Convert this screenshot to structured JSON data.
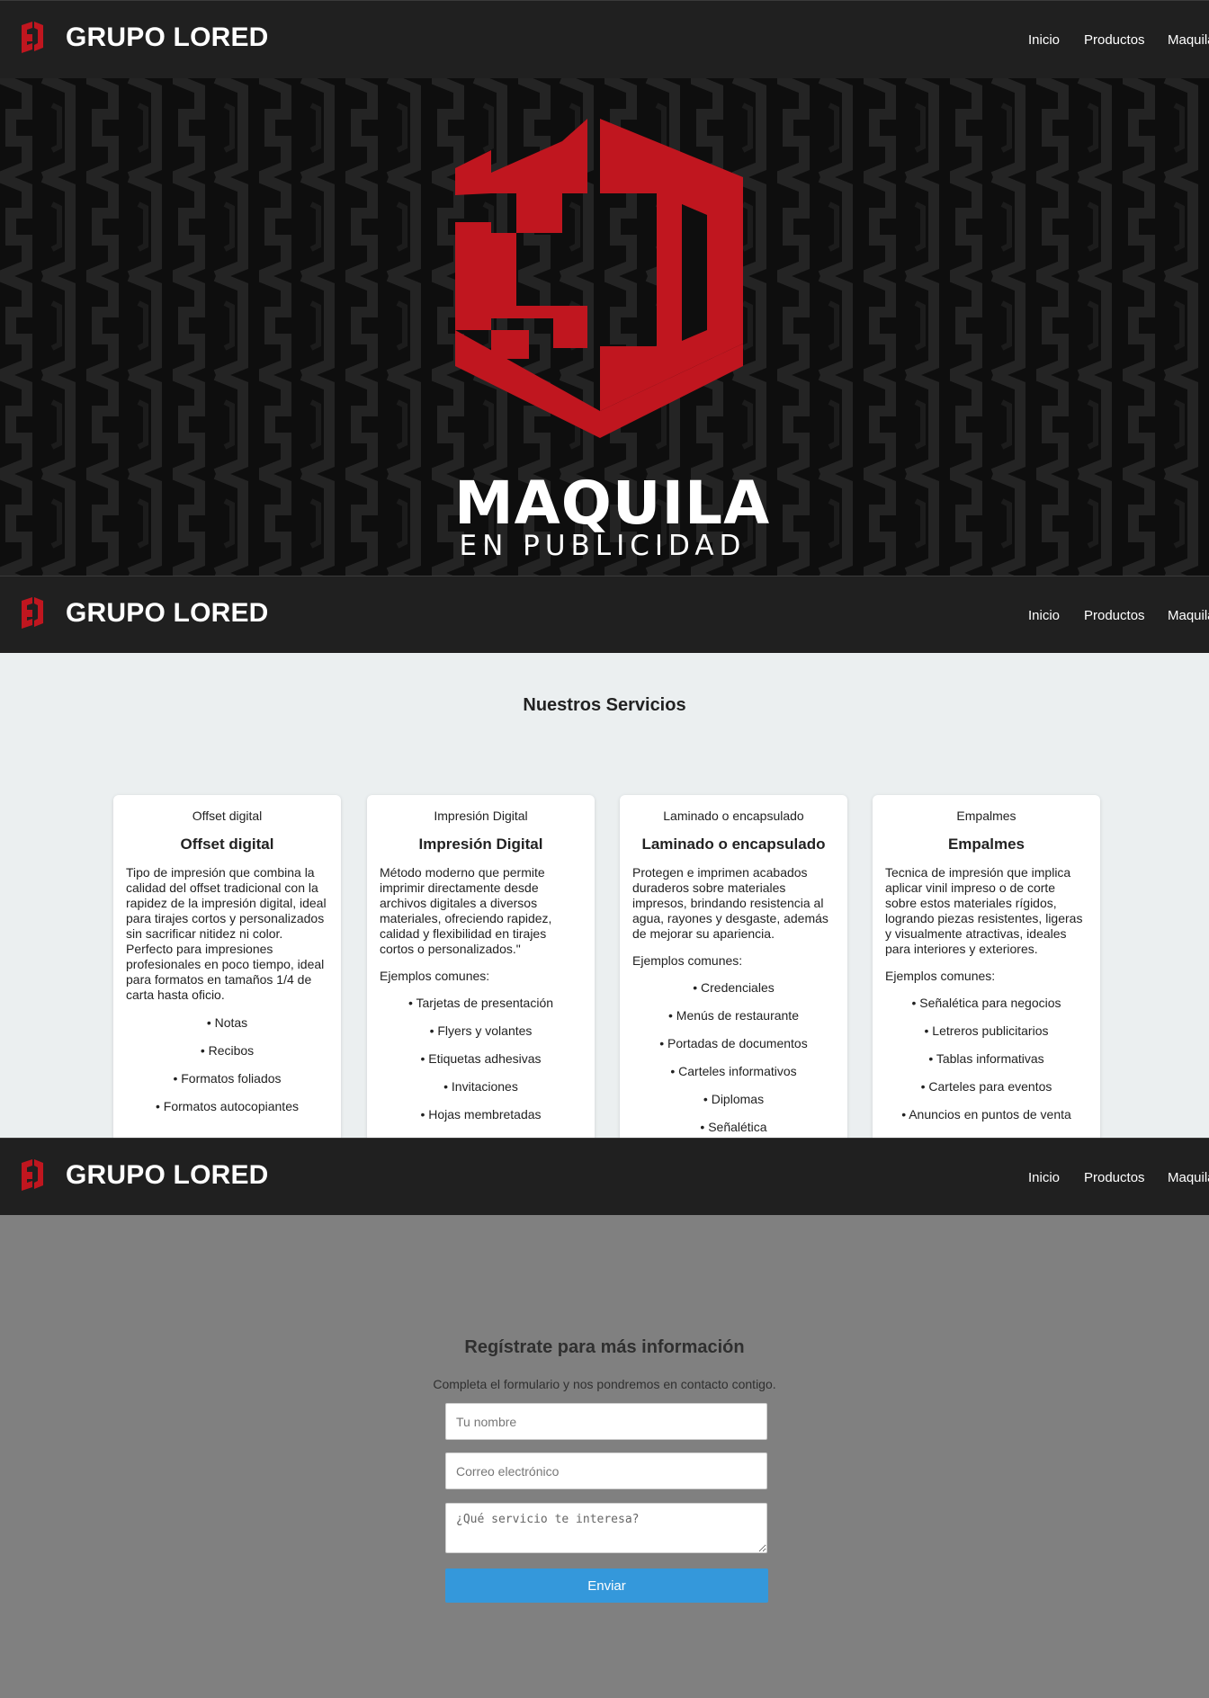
{
  "header": {
    "brand": "GRUPO LORED",
    "nav": [
      "Inicio",
      "Productos",
      "Maquila"
    ]
  },
  "hero": {
    "logo_title": "MAQUILA",
    "logo_subtitle": "EN PUBLICIDAD",
    "accent_color": "#c0161f"
  },
  "services": {
    "title": "Nuestros Servicios",
    "cards": [
      {
        "caption": "Offset digital",
        "title": "Offset digital",
        "description": "Tipo de impresión que combina la calidad del offset tradicional con la rapidez de la impresión digital, ideal para tirajes cortos y personalizados sin sacrificar nitidez ni color. Perfecto para impresiones profesionales en poco tiempo, ideal para formatos en tamaños 1/4 de carta hasta oficio.",
        "examples_label": "",
        "items": [
          "• Notas",
          "• Recibos",
          "• Formatos foliados",
          "• Formatos autocopiantes"
        ]
      },
      {
        "caption": "Impresión Digital",
        "title": "Impresión Digital",
        "description": "Método moderno que permite imprimir directamente desde archivos digitales a diversos materiales, ofreciendo rapidez, calidad y flexibilidad en tirajes cortos o personalizados.\"",
        "examples_label": "Ejemplos comunes:",
        "items": [
          "• Tarjetas de presentación",
          "• Flyers y volantes",
          "• Etiquetas adhesivas",
          "• Invitaciones",
          "• Hojas membretadas"
        ]
      },
      {
        "caption": "Laminado o encapsulado",
        "title": "Laminado o encapsulado",
        "description": "Protegen e imprimen acabados duraderos sobre materiales impresos, brindando resistencia al agua, rayones y desgaste, además de mejorar su apariencia.",
        "examples_label": "Ejemplos comunes:",
        "items": [
          "• Credenciales",
          "• Menús de restaurante",
          "• Portadas de documentos",
          "• Carteles informativos",
          "• Diplomas",
          "• Señalética"
        ]
      },
      {
        "caption": "Empalmes",
        "title": "Empalmes",
        "description": "Tecnica de impresión que implica aplicar vinil impreso o de corte sobre estos materiales rígidos, logrando piezas resistentes, ligeras y visualmente atractivas, ideales para interiores y exteriores.",
        "examples_label": "Ejemplos comunes:",
        "items": [
          "• Señalética para negocios",
          "• Letreros publicitarios",
          "• Tablas informativas",
          "• Carteles para eventos",
          "• Anuncios en puntos de venta"
        ]
      }
    ]
  },
  "signup": {
    "title": "Regístrate para más información",
    "lead": "Completa el formulario y nos pondremos en contacto contigo.",
    "name_placeholder": "Tu nombre",
    "email_placeholder": "Correo electrónico",
    "service_placeholder": "¿Qué servicio te interesa?",
    "submit_label": "Enviar",
    "button_color": "#3498db"
  }
}
